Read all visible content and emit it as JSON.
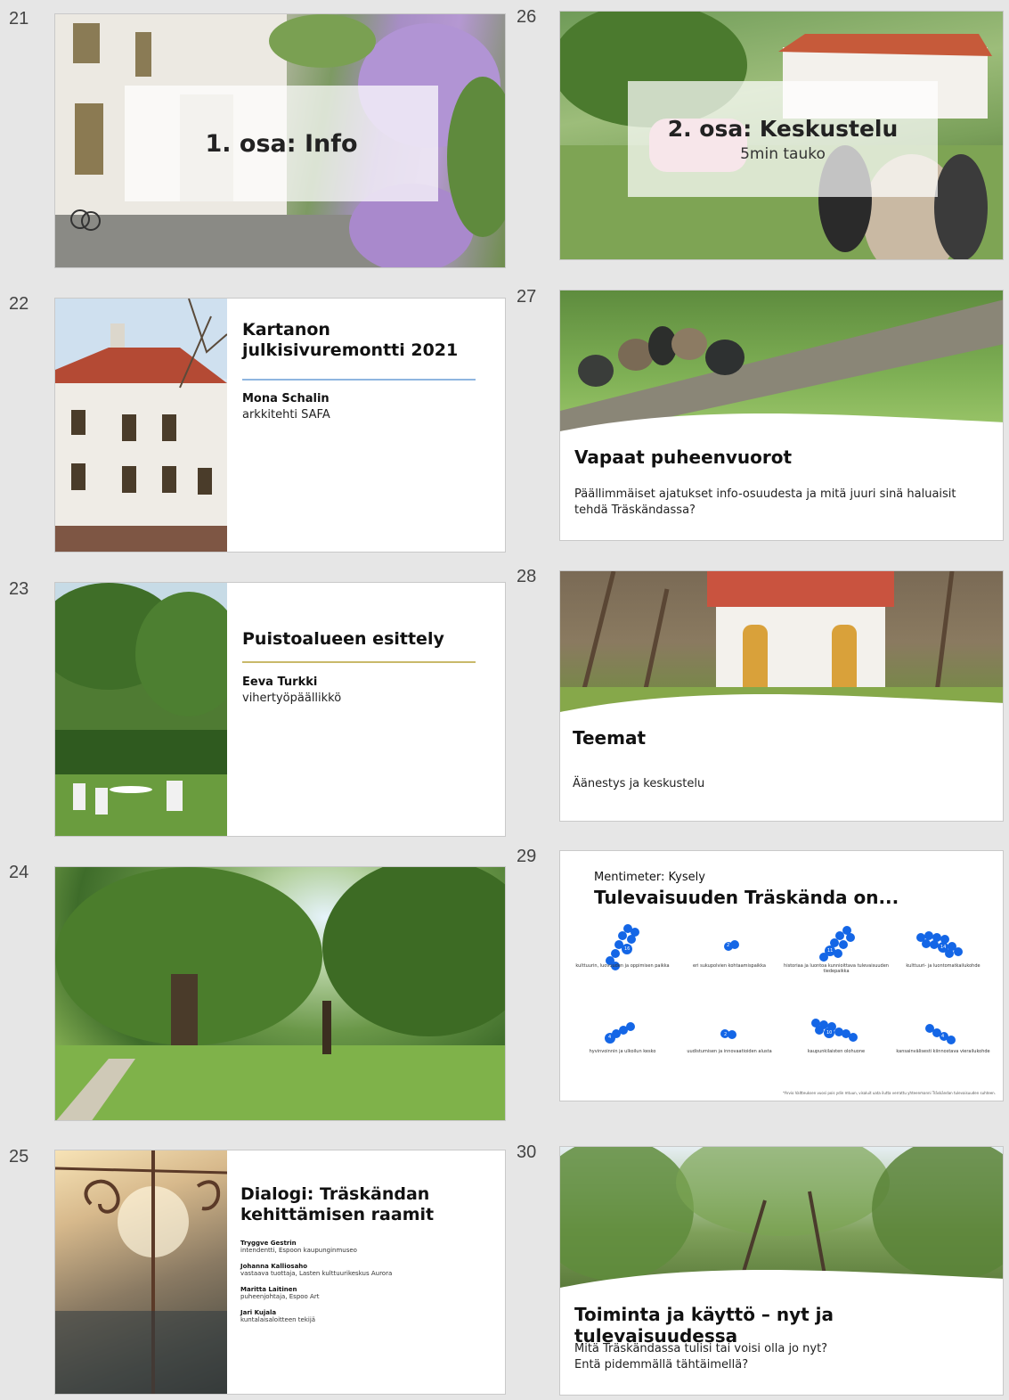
{
  "slides": {
    "s21": {
      "number": "21",
      "title": "1. osa: Info"
    },
    "s22": {
      "number": "22",
      "title": "Kartanon julkisivuremontti 2021",
      "name": "Mona Schalin",
      "role": "arkkitehti SAFA"
    },
    "s23": {
      "number": "23",
      "title": "Puistoalueen esittely",
      "name": "Eeva Turkki",
      "role": "vihertyöpäällikkö"
    },
    "s24": {
      "number": "24"
    },
    "s25": {
      "number": "25",
      "title": "Dialogi: Träskändan kehittämisen raamit",
      "speakers": [
        {
          "name": "Tryggve Gestrin",
          "role": "intendentti, Espoon kaupunginmuseo"
        },
        {
          "name": "Johanna Kalliosaho",
          "role": "vastaava tuottaja, Lasten kulttuurikeskus Aurora"
        },
        {
          "name": "Maritta Laitinen",
          "role": "puheenjohtaja, Espoo Art"
        },
        {
          "name": "Jari Kujala",
          "role": "kuntalaisaloitteen tekijä"
        }
      ]
    },
    "s26": {
      "number": "26",
      "title": "2. osa: Keskustelu",
      "subtitle": "5min tauko"
    },
    "s27": {
      "number": "27",
      "title": "Vapaat puheenvuorot",
      "body": "Päällimmäiset ajatukset info-osuudesta ja mitä juuri sinä haluaisit tehdä Träskändassa?"
    },
    "s28": {
      "number": "28",
      "title": "Teemat",
      "body": "Äänestys ja keskustelu"
    },
    "s29": {
      "number": "29",
      "label": "Mentimeter: Kysely",
      "title": "Tulevaisuuden Träskända on...",
      "categories": [
        {
          "label": "kulttuurin, luovuuden ja oppimisen paikka",
          "count": "16"
        },
        {
          "label": "eri sukupolvien kohtaamispaikka",
          "count": "2"
        },
        {
          "label": "historiaa ja luontoa kunnioittava tulevaisuuden tiedepaikka",
          "count": "11"
        },
        {
          "label": "kulttuuri- ja luontomatkailukohde",
          "count": "14"
        },
        {
          "label": "hyvinvoinnin ja ulkoilun kesko",
          "count": "4"
        },
        {
          "label": "uudistumisen ja innovaatioiden alusta",
          "count": "2"
        },
        {
          "label": "kaupunkilaisten olohuone",
          "count": "10"
        },
        {
          "label": "kansainvälisesti kiinnostava vierailukohde",
          "count": "4"
        }
      ],
      "footnote": "*Arvio Valtteuksen vuosi pois ydin mtuun, visaluit uata ilutta verrattu yhteenmanni Träskändan tulevaisuuden suhteen."
    },
    "s30": {
      "number": "30",
      "title": "Toiminta ja käyttö – nyt ja tulevaisuudessa",
      "body_line1": "Mitä Träskändassa tulisi tai voisi olla jo nyt?",
      "body_line2": "Entä pidemmällä tähtäimellä?"
    }
  },
  "colors": {
    "background": "#e6e6e6",
    "accent_blue": "#1466e6",
    "rule_blue": "#8fb6e0",
    "rule_gold": "#c9b96a"
  },
  "icons": [
    "chevron-scrollwork-image"
  ]
}
